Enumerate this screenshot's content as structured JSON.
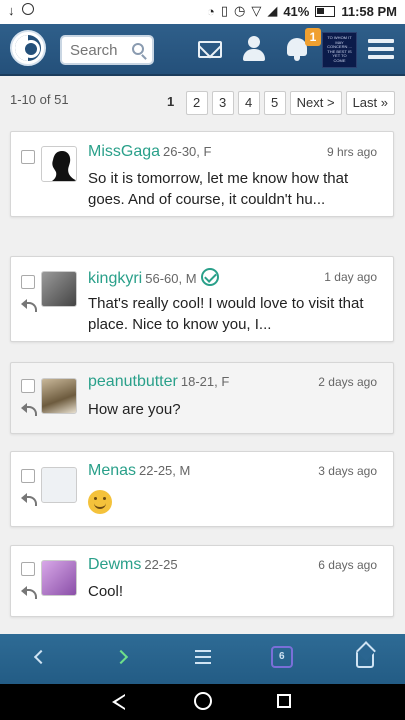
{
  "status_bar": {
    "battery": "41%",
    "time": "11:58 PM"
  },
  "header": {
    "search_placeholder": "Search",
    "notification_count": "1",
    "thumb_text": "TO WHOM IT MAY CONCERN ... THE BEST IS YET TO COME"
  },
  "pagination": {
    "range": "1-10 of 51",
    "pages": [
      "1",
      "2",
      "3",
      "4",
      "5"
    ],
    "next": "Next >",
    "last": "Last »"
  },
  "messages": [
    {
      "username": "MissGaga",
      "meta": "26-30, F",
      "time": "9 hrs ago",
      "text": "So it is tomorrow, let me know how that goes. And of course, it couldn't hu..."
    },
    {
      "username": "kingkyri",
      "meta": "56-60, M",
      "time": "1 day ago",
      "text": "That's really cool! I would love to visit that place. Nice to know you, I..."
    },
    {
      "username": "peanutbutter",
      "meta": "18-21, F",
      "time": "2 days ago",
      "text": "How are you?"
    },
    {
      "username": "Menas",
      "meta": "22-25, M",
      "time": "3 days ago",
      "text": ""
    },
    {
      "username": "Dewms",
      "meta": "22-25",
      "time": "6 days ago",
      "text": "Cool!"
    }
  ],
  "browser_bar": {
    "tab_count": "6"
  }
}
